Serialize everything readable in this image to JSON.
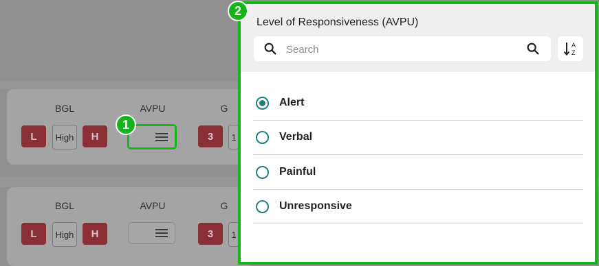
{
  "background_form": {
    "rows": [
      {
        "bgl_label": "BGL",
        "avpu_label": "AVPU",
        "gcs_label": "G",
        "low_badge": "L",
        "bgl_value": "High",
        "high_badge": "H",
        "gcs_badge": "3",
        "gcs_chip": "1"
      },
      {
        "bgl_label": "BGL",
        "avpu_label": "AVPU",
        "gcs_label": "G",
        "low_badge": "L",
        "bgl_value": "High",
        "high_badge": "H",
        "gcs_badge": "3",
        "gcs_chip": "1"
      }
    ]
  },
  "callouts": {
    "step1": "1",
    "step2": "2"
  },
  "panel": {
    "title": "Level of Responsiveness (AVPU)",
    "search_placeholder": "Search",
    "sort_icon": "sort-alpha-down-icon",
    "options": [
      {
        "label": "Alert",
        "selected": true
      },
      {
        "label": "Verbal",
        "selected": false
      },
      {
        "label": "Painful",
        "selected": false
      },
      {
        "label": "Unresponsive",
        "selected": false
      }
    ]
  },
  "colors": {
    "highlight": "#17b51b",
    "radio": "#1e7f80",
    "badge": "#8a2f35"
  }
}
